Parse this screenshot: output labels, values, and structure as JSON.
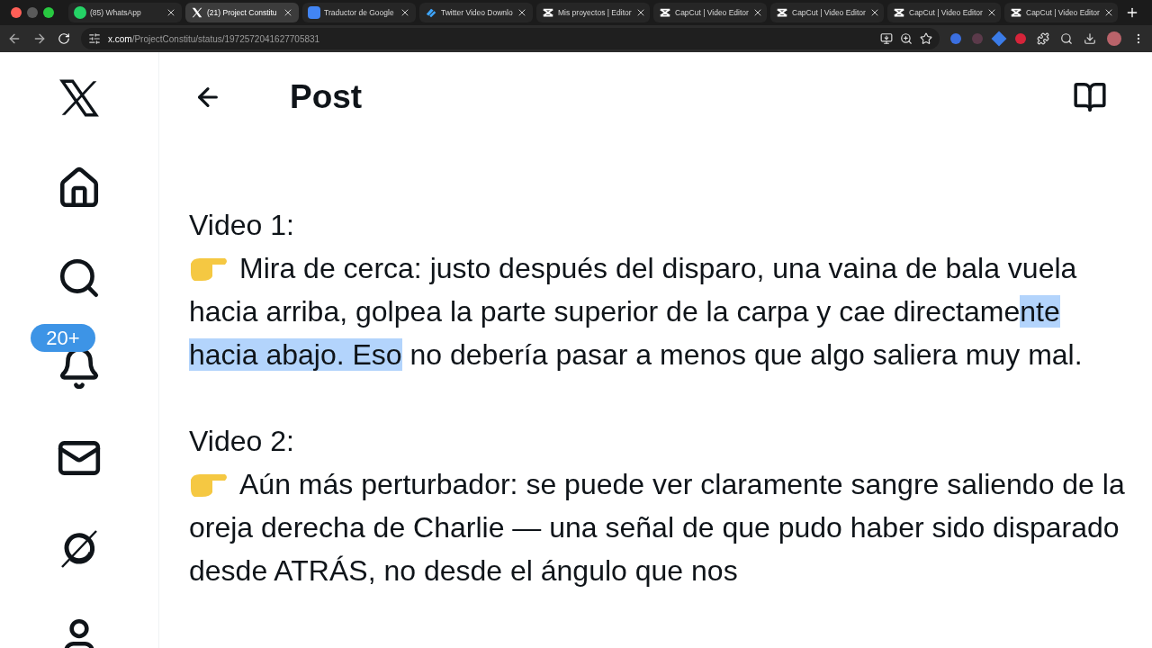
{
  "tabs": [
    {
      "title": "(85) WhatsApp",
      "kind": "whatsapp",
      "selected": false
    },
    {
      "title": "(21) Project Constitu",
      "kind": "x",
      "selected": true
    },
    {
      "title": "Traductor de Google",
      "kind": "translate",
      "selected": false
    },
    {
      "title": "Twitter Video Downlo",
      "kind": "download",
      "selected": false
    },
    {
      "title": "Mis proyectos | Editor",
      "kind": "capcut",
      "selected": false
    },
    {
      "title": "CapCut | Video Editor",
      "kind": "capcut",
      "selected": false
    },
    {
      "title": "CapCut | Video Editor",
      "kind": "capcut",
      "selected": false
    },
    {
      "title": "CapCut | Video Editor",
      "kind": "capcut",
      "selected": false
    },
    {
      "title": "CapCut | Video Editor",
      "kind": "capcut",
      "selected": false
    }
  ],
  "address_bar": {
    "host": "x.com",
    "path": "/ProjectConstitu/status/1972572041627705831"
  },
  "sidebar": {
    "notifications_badge": "20+"
  },
  "header": {
    "title": "Post"
  },
  "post": [
    {
      "kind": "heading",
      "text": "Video 1:"
    },
    {
      "kind": "bullet",
      "segments": [
        {
          "text": "Mira de cerca: justo después del disparo, una vaina de bala vuela hacia arriba, golpea la parte superior de la carpa y cae directame",
          "highlighted": false
        },
        {
          "text": "nte hacia abajo. Eso",
          "highlighted": true
        },
        {
          "text": " no debería pasar a menos que algo saliera muy mal.",
          "highlighted": false
        }
      ]
    },
    {
      "kind": "heading",
      "text": "Video 2:"
    },
    {
      "kind": "bullet",
      "segments": [
        {
          "text": "Aún más perturbador: se puede ver claramente sangre saliendo de la oreja derecha de Charlie — una señal de que pudo haber sido disparado desde ATRÁS, no desde el ángulo que nos",
          "highlighted": false
        }
      ]
    }
  ]
}
